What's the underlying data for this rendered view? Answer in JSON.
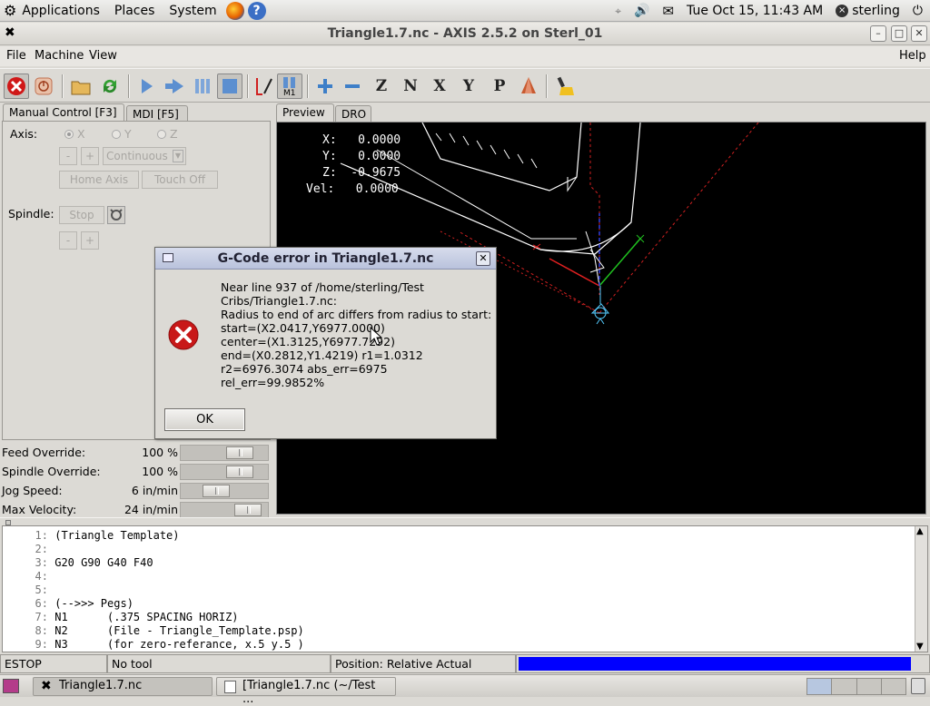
{
  "top_panel": {
    "menus": [
      "Applications",
      "Places",
      "System"
    ],
    "datetime": "Tue Oct 15, 11:43 AM",
    "user": "sterling"
  },
  "window": {
    "title": "Triangle1.7.nc - AXIS 2.5.2 on Sterl_01"
  },
  "menubar": {
    "file": "File",
    "machine": "Machine",
    "view": "View",
    "help": "Help"
  },
  "toolbar": {
    "m1_label": "M1"
  },
  "left_tabs": {
    "manual": "Manual Control [F3]",
    "mdi": "MDI [F5]"
  },
  "manual": {
    "axis_label": "Axis:",
    "axes": [
      "X",
      "Y",
      "Z"
    ],
    "selected_axis": "X",
    "minus": "-",
    "plus": "+",
    "jog_mode": "Continuous",
    "home_axis": "Home Axis",
    "touch_off": "Touch Off",
    "spindle_label": "Spindle:",
    "stop": "Stop"
  },
  "overrides": {
    "feed": {
      "label": "Feed Override:",
      "value": "100 %",
      "position": 0.78
    },
    "spindle": {
      "label": "Spindle Override:",
      "value": "100 %",
      "position": 0.78
    },
    "jog": {
      "label": "Jog Speed:",
      "value": "6 in/min",
      "position": 0.38
    },
    "maxvel": {
      "label": "Max Velocity:",
      "value": "24 in/min",
      "position": 0.92
    }
  },
  "right_tabs": {
    "preview": "Preview",
    "dro": "DRO"
  },
  "dro": {
    "x": "X:   0.0000",
    "y": "Y:   0.0000",
    "z": "Z:  -0.9675",
    "vel": "Vel:   0.0000"
  },
  "dialog": {
    "title": "G-Code error in Triangle1.7.nc",
    "message": "Near line 937 of /home/sterling/Test\nCribs/Triangle1.7.nc:\nRadius to end of arc differs from radius to start:\nstart=(X2.0417,Y6977.0000)\ncenter=(X1.3125,Y6977.7292)\nend=(X0.2812,Y1.4219) r1=1.0312\nr2=6976.3074 abs_err=6975\nrel_err=99.9852%",
    "ok": "OK"
  },
  "gcode": [
    {
      "n": "1:",
      "text": "(Triangle Template)"
    },
    {
      "n": "2:",
      "text": ""
    },
    {
      "n": "3:",
      "text": "G20 G90 G40 F40"
    },
    {
      "n": "4:",
      "text": ""
    },
    {
      "n": "5:",
      "text": ""
    },
    {
      "n": "6:",
      "text": "(-->>> Pegs)"
    },
    {
      "n": "7:",
      "text": "N1      (.375 SPACING HORIZ)"
    },
    {
      "n": "8:",
      "text": "N2      (File - Triangle_Template.psp)"
    },
    {
      "n": "9:",
      "text": "N3      (for zero-referance, x.5 y.5 )"
    }
  ],
  "status": {
    "estop": "ESTOP",
    "tool": "No tool",
    "position": "Position: Relative Actual",
    "progress": 1.0,
    "progress_color": "#0000ff"
  },
  "taskbar": {
    "items": [
      "Triangle1.7.nc",
      "[Triangle1.7.nc (~/Test ..."
    ]
  }
}
